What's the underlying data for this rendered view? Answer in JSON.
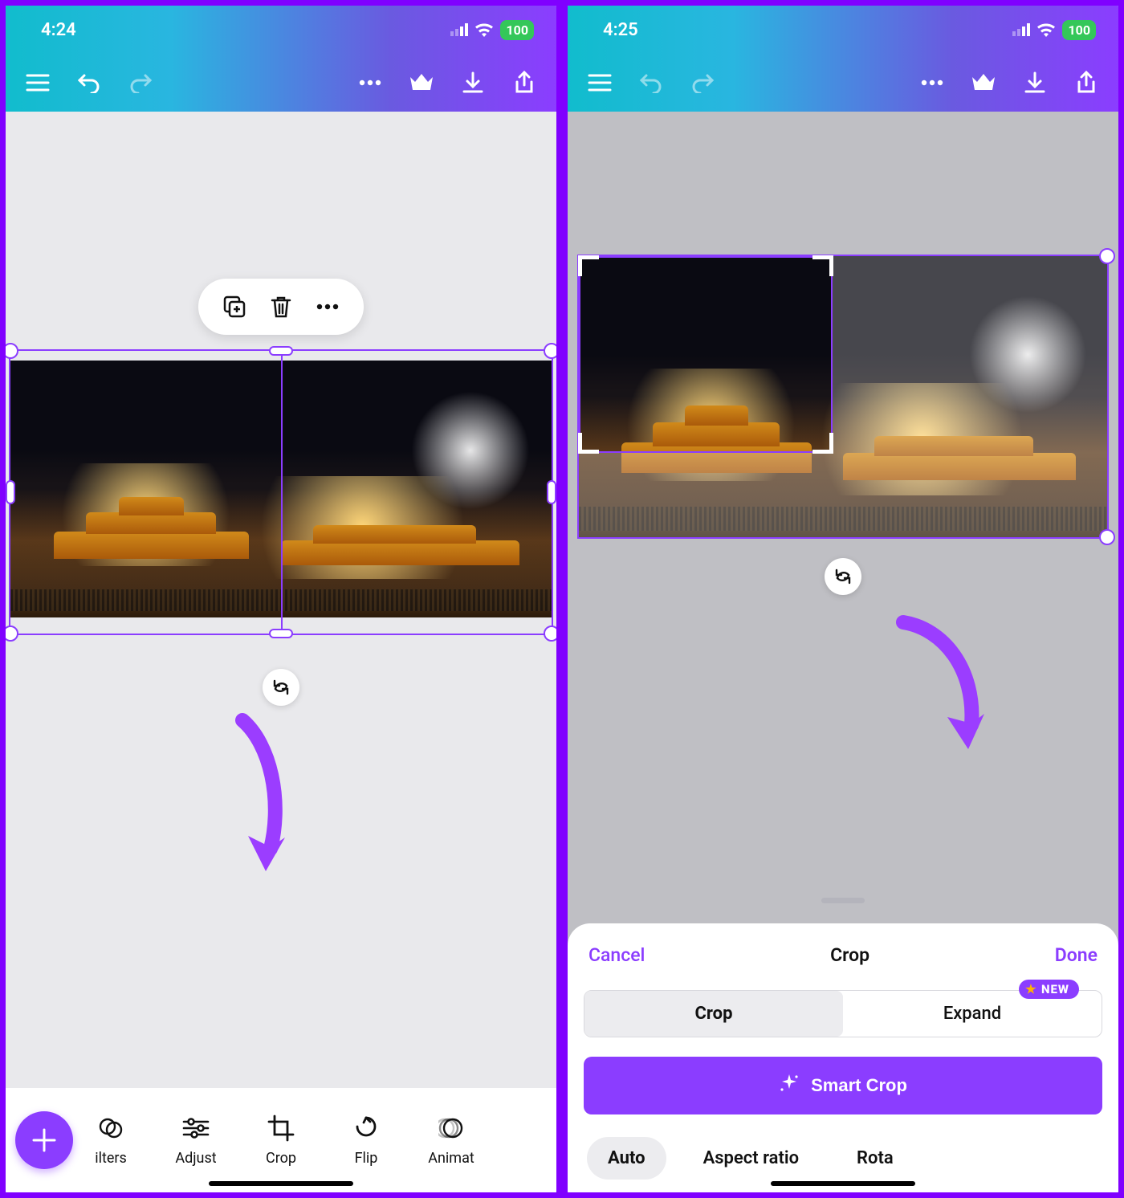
{
  "left": {
    "status": {
      "time": "4:24",
      "battery": "100"
    },
    "float": {
      "items": [
        "duplicate",
        "trash",
        "more"
      ]
    },
    "tools": {
      "items": [
        {
          "name": "filters",
          "label": "ilters"
        },
        {
          "name": "adjust",
          "label": "Adjust"
        },
        {
          "name": "crop",
          "label": "Crop"
        },
        {
          "name": "flip",
          "label": "Flip"
        },
        {
          "name": "animate",
          "label": "Animat"
        }
      ]
    }
  },
  "right": {
    "status": {
      "time": "4:25",
      "battery": "100"
    },
    "sheet": {
      "cancel": "Cancel",
      "title": "Crop",
      "done": "Done",
      "seg": {
        "crop": "Crop",
        "expand": "Expand",
        "badge": "NEW"
      },
      "smart": "Smart Crop",
      "chips": {
        "auto": "Auto",
        "aspect": "Aspect ratio",
        "rotate": "Rota"
      }
    }
  }
}
